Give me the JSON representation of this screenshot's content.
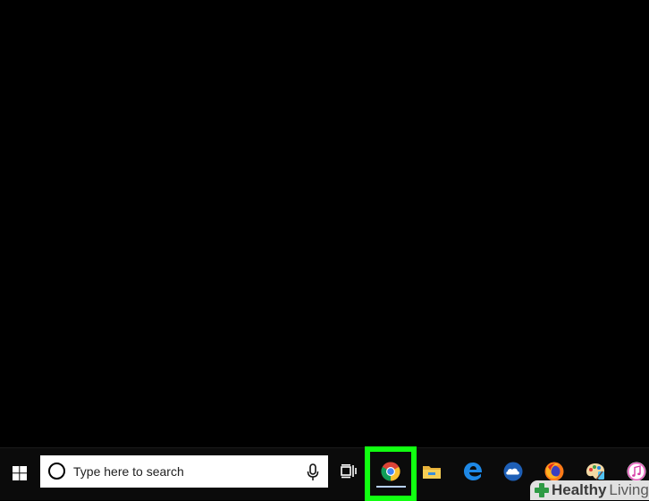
{
  "desktop": {
    "background": "#000000"
  },
  "taskbar": {
    "start": {
      "icon": "windows-logo-icon"
    },
    "search": {
      "placeholder": "Type here to search",
      "left_icon": "cortana-circle-icon",
      "right_icon": "microphone-icon"
    },
    "task_view": {
      "icon": "task-view-icon"
    },
    "pinned_apps": [
      {
        "name": "Google Chrome",
        "icon": "chrome-icon",
        "active": true,
        "highlighted": true
      },
      {
        "name": "File Explorer",
        "icon": "folder-icon"
      },
      {
        "name": "Microsoft Edge",
        "icon": "edge-icon"
      },
      {
        "name": "Cloud app",
        "icon": "cloud-app-icon"
      },
      {
        "name": "Firefox",
        "icon": "firefox-icon"
      },
      {
        "name": "Paint app",
        "icon": "paint-icon"
      },
      {
        "name": "iTunes",
        "icon": "itunes-icon"
      }
    ],
    "highlight_color": "#11ff11"
  },
  "watermark": {
    "word1": "Healthy",
    "word2": "Living",
    "icon": "plus-icon",
    "color": "#2e9b45"
  }
}
